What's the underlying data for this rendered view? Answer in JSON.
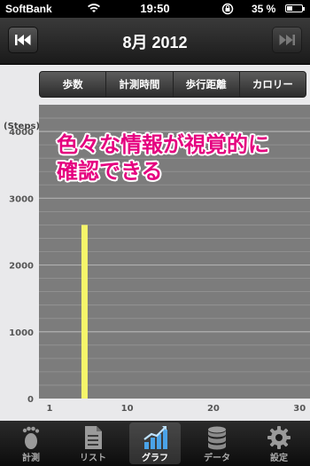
{
  "status_bar": {
    "carrier": "SoftBank",
    "time": "19:50",
    "battery_percent": "35 %",
    "battery_level": 0.35
  },
  "nav": {
    "title": "8月 2012",
    "prev_icon": "skip-previous-icon",
    "next_icon": "skip-next-icon"
  },
  "segments": [
    {
      "label": "歩数",
      "active": true
    },
    {
      "label": "計測時間",
      "active": false
    },
    {
      "label": "歩行距離",
      "active": false
    },
    {
      "label": "カロリー",
      "active": false
    }
  ],
  "annotation": {
    "line1": "色々な情報が視覚的に",
    "line2": "確認できる"
  },
  "chart_data": {
    "type": "bar",
    "ylabel": "(Steps)",
    "ylim": [
      0,
      4400
    ],
    "yticks": [
      0,
      1000,
      2000,
      3000,
      4000
    ],
    "xlim": [
      1,
      31
    ],
    "xticks": [
      1,
      10,
      20,
      30
    ],
    "grid": true,
    "x": [
      5
    ],
    "values": [
      2600
    ],
    "bar_color": "#f5f56a",
    "background_color": "#7c7c7c"
  },
  "tabs": [
    {
      "label": "計測",
      "icon": "footprint-icon",
      "active": false
    },
    {
      "label": "リスト",
      "icon": "document-icon",
      "active": false
    },
    {
      "label": "グラフ",
      "icon": "chart-icon",
      "active": true
    },
    {
      "label": "データ",
      "icon": "database-icon",
      "active": false
    },
    {
      "label": "設定",
      "icon": "gear-icon",
      "active": false
    }
  ]
}
